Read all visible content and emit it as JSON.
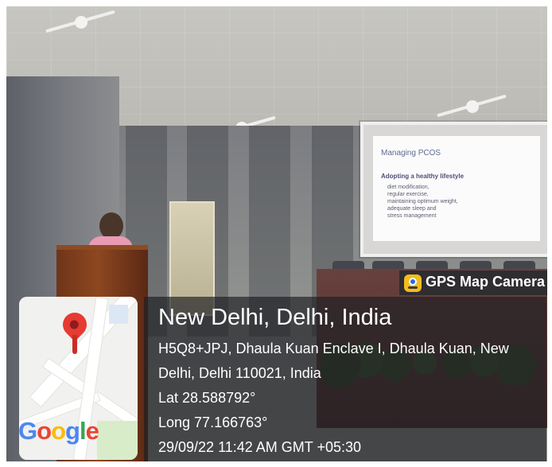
{
  "photo": {
    "scene": "",
    "screen": {
      "title": "Managing PCOS",
      "heading": "Adopting a healthy lifestyle",
      "items": [
        "diet modification,",
        "regular exercise,",
        "maintaining optimum weight,",
        "adequate sleep and",
        "stress management"
      ]
    }
  },
  "overlay": {
    "badge": "GPS Map Camera",
    "location_title": "New Delhi, Delhi, India",
    "address_line_1": "H5Q8+JPJ, Dhaula Kuan Enclave I, Dhaula Kuan, New",
    "address_line_2": "Delhi, Delhi 110021, India",
    "latitude": "Lat 28.588792°",
    "longitude": "Long 77.166763°",
    "timestamp": "29/09/22 11:42 AM GMT +05:30",
    "map_logo": "Google"
  }
}
